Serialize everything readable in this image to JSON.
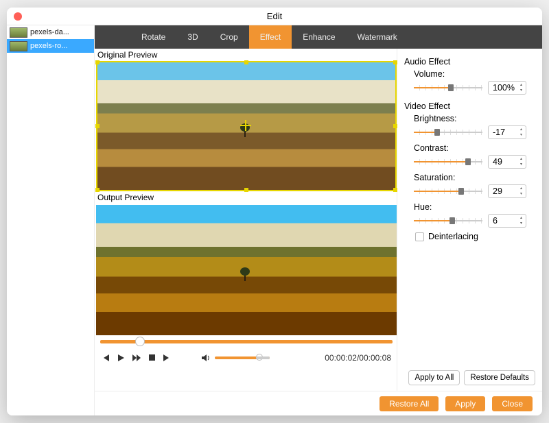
{
  "window": {
    "title": "Edit"
  },
  "sidebar": {
    "items": [
      {
        "label": "pexels-da..."
      },
      {
        "label": "pexels-ro..."
      }
    ],
    "selected_index": 1
  },
  "tabs": {
    "items": [
      {
        "label": "Rotate"
      },
      {
        "label": "3D"
      },
      {
        "label": "Crop"
      },
      {
        "label": "Effect"
      },
      {
        "label": "Enhance"
      },
      {
        "label": "Watermark"
      }
    ],
    "active_index": 3
  },
  "preview": {
    "original_label": "Original Preview",
    "output_label": "Output Preview"
  },
  "playback": {
    "time_display": "00:00:02/00:00:08"
  },
  "panel": {
    "audio_title": "Audio Effect",
    "video_title": "Video Effect",
    "volume": {
      "label": "Volume:",
      "value": "100%",
      "fill": 50
    },
    "brightness": {
      "label": "Brightness:",
      "value": "-17",
      "fill": 30
    },
    "contrast": {
      "label": "Contrast:",
      "value": "49",
      "fill": 75
    },
    "saturation": {
      "label": "Saturation:",
      "value": "29",
      "fill": 65
    },
    "hue": {
      "label": "Hue:",
      "value": "6",
      "fill": 52
    },
    "deinterlacing_label": "Deinterlacing",
    "apply_all": "Apply to All",
    "restore_defaults": "Restore Defaults"
  },
  "footer": {
    "restore_all": "Restore All",
    "apply": "Apply",
    "close": "Close"
  }
}
